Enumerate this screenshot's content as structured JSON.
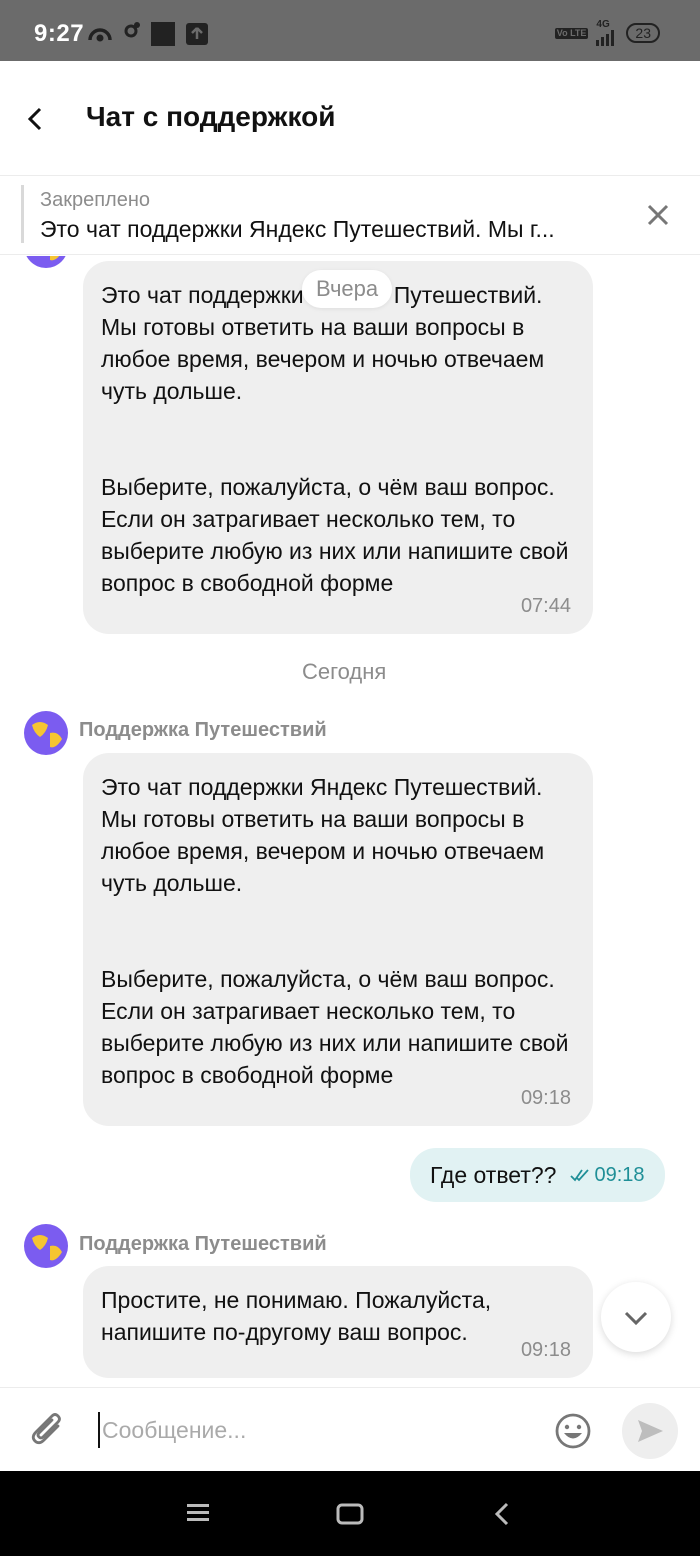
{
  "status_bar": {
    "time": "9:27",
    "network": "4G",
    "volte": "Vo LTE",
    "battery": "23"
  },
  "header": {
    "title": "Чат с поддержкой"
  },
  "pinned": {
    "label": "Закреплено",
    "text": "Это чат поддержки Яндекс Путешествий. Мы г..."
  },
  "chat": {
    "date_yesterday": "Вчера",
    "date_today": "Сегодня",
    "sender_name": "Поддержка Путешествий",
    "messages": [
      {
        "text_top": "Это чат поддержки Яндекс Путешествий. Мы готовы ответить на ваши вопросы в любое время, вечером и ночью отвечаем чуть дольше.",
        "text_bottom": "Выберите, пожалуйста, о чём ваш вопрос. Если он затрагивает несколько тем, то выберите любую из них или напишите свой вопрос в свободной форме",
        "time": "07:44"
      },
      {
        "text_top": "Это чат поддержки Яндекс Путешествий. Мы готовы ответить на ваши вопросы в любое время, вечером и ночью отвечаем чуть дольше.",
        "text_bottom": "Выберите, пожалуйста, о чём ваш вопрос. Если он затрагивает несколько тем, то выберите любую из них или напишите свой вопрос в свободной форме",
        "time": "09:18"
      },
      {
        "text": "Где ответ??",
        "time": "09:18",
        "outgoing": true
      },
      {
        "text": "Простите, не понимаю. Пожалуйста, напишите по-другому ваш вопрос.",
        "time": "09:18"
      }
    ]
  },
  "input": {
    "placeholder": "Сообщение..."
  },
  "colors": {
    "incoming_bubble": "#efefef",
    "outgoing_bubble": "#e1f2f3",
    "outgoing_time": "#1f8f97",
    "avatar_bg": "#7b5cf0",
    "avatar_globe": "#f6c531"
  }
}
